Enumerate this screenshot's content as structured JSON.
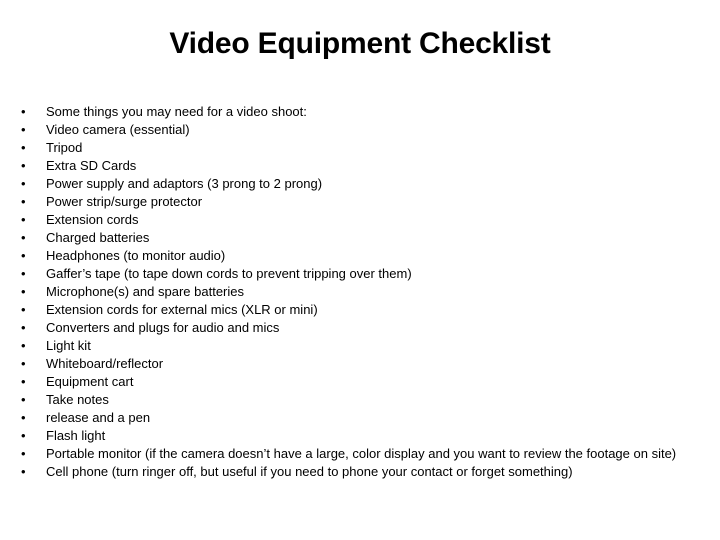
{
  "slide": {
    "title": "Video Equipment Checklist",
    "bullet_glyph": "•",
    "text_color": "#000000",
    "background_color": "#ffffff",
    "items": [
      {
        "text": "Some things you may need for a video shoot:"
      },
      {
        "text": "Video camera (essential)"
      },
      {
        "text": "Tripod"
      },
      {
        "text": "Extra SD Cards"
      },
      {
        "text": "Power supply and adaptors (3 prong to 2 prong)"
      },
      {
        "text": "Power strip/surge protector"
      },
      {
        "text": "Extension cords"
      },
      {
        "text": "Charged batteries"
      },
      {
        "text": "Headphones (to monitor audio)"
      },
      {
        "text": "Gaffer’s tape (to tape down cords to prevent tripping over them)"
      },
      {
        "text": "Microphone(s) and spare batteries"
      },
      {
        "text": "Extension cords for external mics (XLR or mini)"
      },
      {
        "text": "Converters and plugs for audio and mics"
      },
      {
        "text": "Light kit"
      },
      {
        "text": "Whiteboard/reflector"
      },
      {
        "text": "Equipment cart"
      },
      {
        "text": "Take notes"
      },
      {
        "text": "release and a pen"
      },
      {
        "text": "Flash light"
      },
      {
        "text": "Portable monitor (if the camera doesn’t have a large, color display and you want to review the footage on site)"
      },
      {
        "text": "Cell phone (turn ringer off, but useful if you need to phone your contact or forget something)"
      }
    ]
  }
}
